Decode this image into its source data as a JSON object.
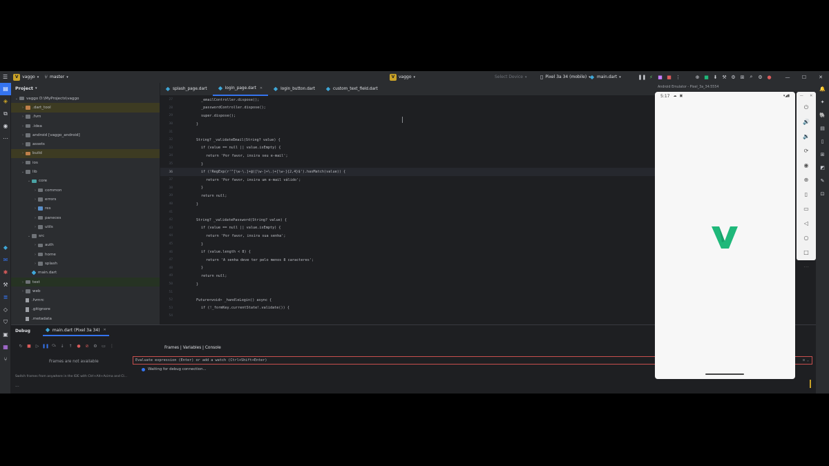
{
  "titlebar": {
    "project_badge": "V",
    "project": "vaggo",
    "branch": "master",
    "center_badge": "V",
    "center_project": "vaggo",
    "device_selector": "Select Device",
    "running_device": "Pixel 3a 34 (mobile)",
    "run_config": "main.dart"
  },
  "project_panel": {
    "title": "Project",
    "tree": [
      {
        "label": "vaggo  D:\\MyProjects\\vaggo",
        "depth": 0,
        "kind": "folder",
        "open": true,
        "hl": ""
      },
      {
        "label": ".dart_tool",
        "depth": 1,
        "kind": "folder-orange",
        "open": false,
        "hl": "yellow"
      },
      {
        "label": ".fvm",
        "depth": 1,
        "kind": "folder",
        "open": false,
        "hl": ""
      },
      {
        "label": ".idea",
        "depth": 1,
        "kind": "folder",
        "open": false,
        "hl": ""
      },
      {
        "label": "android [vaggo_android]",
        "depth": 1,
        "kind": "folder",
        "open": false,
        "hl": ""
      },
      {
        "label": "assets",
        "depth": 1,
        "kind": "folder",
        "open": false,
        "hl": ""
      },
      {
        "label": "build",
        "depth": 1,
        "kind": "folder-orange",
        "open": false,
        "hl": "yellow"
      },
      {
        "label": "ios",
        "depth": 1,
        "kind": "folder",
        "open": false,
        "hl": ""
      },
      {
        "label": "lib",
        "depth": 1,
        "kind": "folder",
        "open": true,
        "hl": ""
      },
      {
        "label": "core",
        "depth": 2,
        "kind": "folder-teal",
        "open": true,
        "hl": ""
      },
      {
        "label": "common",
        "depth": 3,
        "kind": "folder",
        "open": false,
        "hl": ""
      },
      {
        "label": "errors",
        "depth": 3,
        "kind": "folder",
        "open": false,
        "hl": ""
      },
      {
        "label": "res",
        "depth": 3,
        "kind": "folder-blue",
        "open": false,
        "hl": ""
      },
      {
        "label": "paneces",
        "depth": 3,
        "kind": "folder",
        "open": false,
        "hl": ""
      },
      {
        "label": "utils",
        "depth": 3,
        "kind": "folder",
        "open": false,
        "hl": ""
      },
      {
        "label": "src",
        "depth": 2,
        "kind": "folder",
        "open": true,
        "hl": ""
      },
      {
        "label": "auth",
        "depth": 3,
        "kind": "folder",
        "open": false,
        "hl": ""
      },
      {
        "label": "home",
        "depth": 3,
        "kind": "folder",
        "open": false,
        "hl": ""
      },
      {
        "label": "splash",
        "depth": 3,
        "kind": "folder",
        "open": false,
        "hl": ""
      },
      {
        "label": "main.dart",
        "depth": 2,
        "kind": "dart",
        "open": null,
        "hl": ""
      },
      {
        "label": "test",
        "depth": 1,
        "kind": "folder",
        "open": false,
        "hl": "green"
      },
      {
        "label": "web",
        "depth": 1,
        "kind": "folder",
        "open": false,
        "hl": ""
      },
      {
        "label": ".fvmrc",
        "depth": 1,
        "kind": "file",
        "open": null,
        "hl": ""
      },
      {
        "label": ".gitignore",
        "depth": 1,
        "kind": "file",
        "open": null,
        "hl": ""
      },
      {
        "label": ".metadata",
        "depth": 1,
        "kind": "file",
        "open": null,
        "hl": ""
      }
    ]
  },
  "tabs": [
    {
      "label": "splash_page.dart",
      "active": false
    },
    {
      "label": "login_page.dart",
      "active": true
    },
    {
      "label": "login_button.dart",
      "active": false
    },
    {
      "label": "custom_text_field.dart",
      "active": false
    }
  ],
  "editor": {
    "current_line": 36,
    "lines": [
      {
        "n": 27,
        "indent": 2,
        "text": "_emailController.dispose();"
      },
      {
        "n": 28,
        "indent": 2,
        "text": "_passwordController.dispose();"
      },
      {
        "n": 29,
        "indent": 2,
        "text": "super.dispose();"
      },
      {
        "n": 30,
        "indent": 1,
        "text": "}"
      },
      {
        "n": 31,
        "indent": 0,
        "text": ""
      },
      {
        "n": 32,
        "indent": 1,
        "text": "String? _validateEmail(String? value) {"
      },
      {
        "n": 33,
        "indent": 2,
        "text": "if (value == null || value.isEmpty) {"
      },
      {
        "n": 34,
        "indent": 3,
        "text": "return 'Por favor, insira seu e-mail';"
      },
      {
        "n": 35,
        "indent": 2,
        "text": "}"
      },
      {
        "n": 36,
        "indent": 2,
        "text": "if (!RegExp(r'^[\\w-\\.]+@([\\w-]+\\.)+[\\w-]{2,4}$').hasMatch(value)) {"
      },
      {
        "n": 37,
        "indent": 3,
        "text": "return 'Por favor, insira um e-mail válido';"
      },
      {
        "n": 38,
        "indent": 2,
        "text": "}"
      },
      {
        "n": 39,
        "indent": 2,
        "text": "return null;"
      },
      {
        "n": 40,
        "indent": 1,
        "text": "}"
      },
      {
        "n": 41,
        "indent": 0,
        "text": ""
      },
      {
        "n": 42,
        "indent": 1,
        "text": "String? _validatePassword(String? value) {"
      },
      {
        "n": 43,
        "indent": 2,
        "text": "if (value == null || value.isEmpty) {"
      },
      {
        "n": 44,
        "indent": 3,
        "text": "return 'Por favor, insira sua senha';"
      },
      {
        "n": 45,
        "indent": 2,
        "text": "}"
      },
      {
        "n": 46,
        "indent": 2,
        "text": "if (value.length < 8) {"
      },
      {
        "n": 47,
        "indent": 3,
        "text": "return 'A senha deve ter pelo menos 8 caracteres';"
      },
      {
        "n": 48,
        "indent": 2,
        "text": "}"
      },
      {
        "n": 49,
        "indent": 2,
        "text": "return null;"
      },
      {
        "n": 50,
        "indent": 1,
        "text": "}"
      },
      {
        "n": 51,
        "indent": 0,
        "text": ""
      },
      {
        "n": 52,
        "indent": 1,
        "text": "Future<void> _handleLogin() async {"
      },
      {
        "n": 53,
        "indent": 2,
        "text": "if (!_formKey.currentState!.validate()) {"
      },
      {
        "n": 54,
        "indent": 3,
        "text": ""
      }
    ]
  },
  "debug": {
    "title": "Debug",
    "session_tab": "main.dart (Pixel 3a 34)",
    "frames_tabs": "Frames | Variables | Console",
    "frames_empty": "Frames are not available",
    "eval_placeholder": "Evaluate expression (Enter) or add a watch (Ctrl+Shift+Enter)",
    "waiting": "Waiting for debug connection...",
    "switch_tip": "Switch frames from anywhere in the IDE with Ctrl+Alt+Acima and Cl...",
    "more": "..."
  },
  "emulator": {
    "title": "Android Emulator - Pixel_3a_34:5554",
    "time": "5:17",
    "brand_color": "#1fb87a"
  }
}
